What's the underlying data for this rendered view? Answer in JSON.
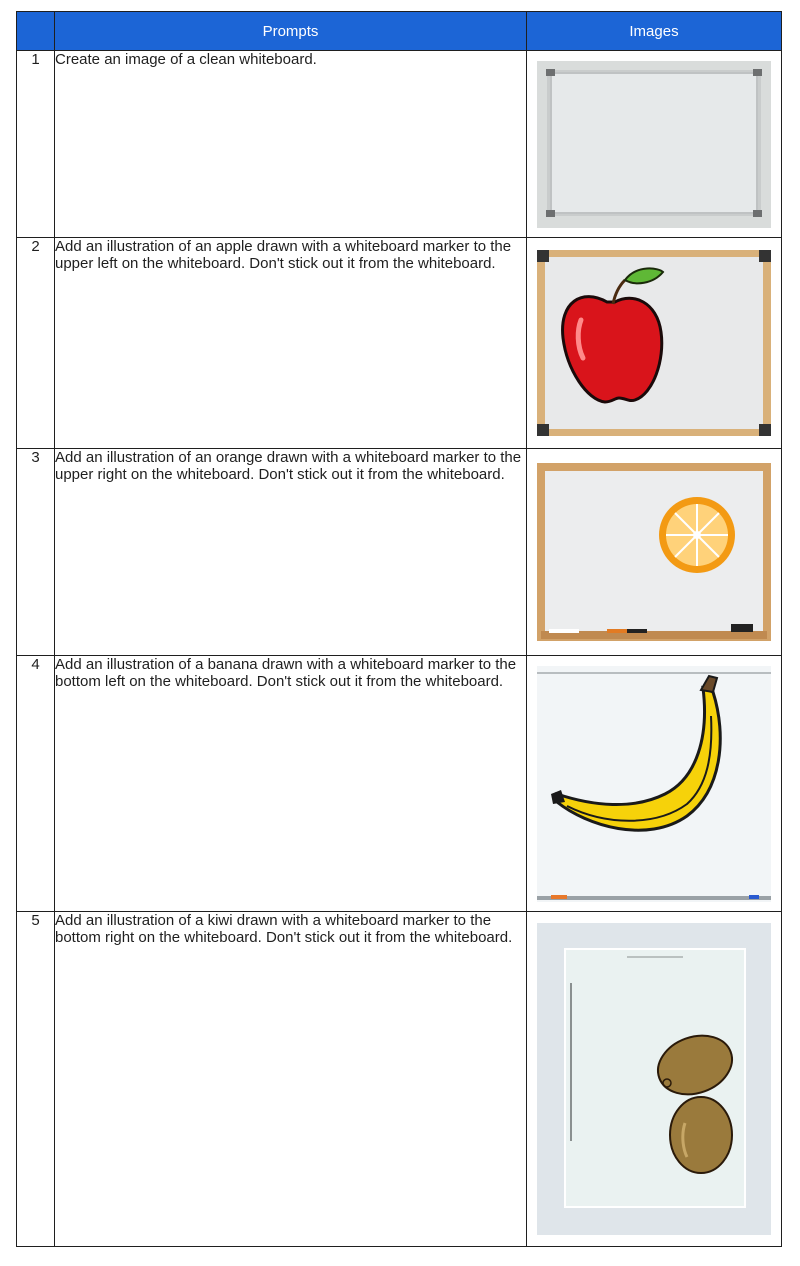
{
  "header": {
    "col_index": "",
    "col_prompts": "Prompts",
    "col_images": "Images"
  },
  "rows": [
    {
      "index": "1",
      "prompt": "Create an image of a clean whiteboard.",
      "image": "clean-whiteboard"
    },
    {
      "index": "2",
      "prompt": "Add an illustration of an apple drawn with a whiteboard marker to the upper left on the whiteboard. Don't stick out it from the whiteboard.",
      "image": "whiteboard-with-apple"
    },
    {
      "index": "3",
      "prompt": "Add an illustration of an orange drawn with a whiteboard marker to the upper right on the whiteboard. Don't stick out it from the whiteboard.",
      "image": "whiteboard-with-orange"
    },
    {
      "index": "4",
      "prompt": "Add an illustration of a banana drawn with a whiteboard marker to the bottom left on the whiteboard. Don't stick out it from the whiteboard.",
      "image": "whiteboard-with-banana"
    },
    {
      "index": "5",
      "prompt": "Add an illustration of a kiwi drawn with a whiteboard marker to the bottom right on the whiteboard. Don't stick out it from the whiteboard.",
      "image": "whiteboard-with-kiwi"
    }
  ],
  "colors": {
    "header_bg": "#1c65d6",
    "header_text": "#ffffff",
    "border": "#1f1f1f"
  }
}
